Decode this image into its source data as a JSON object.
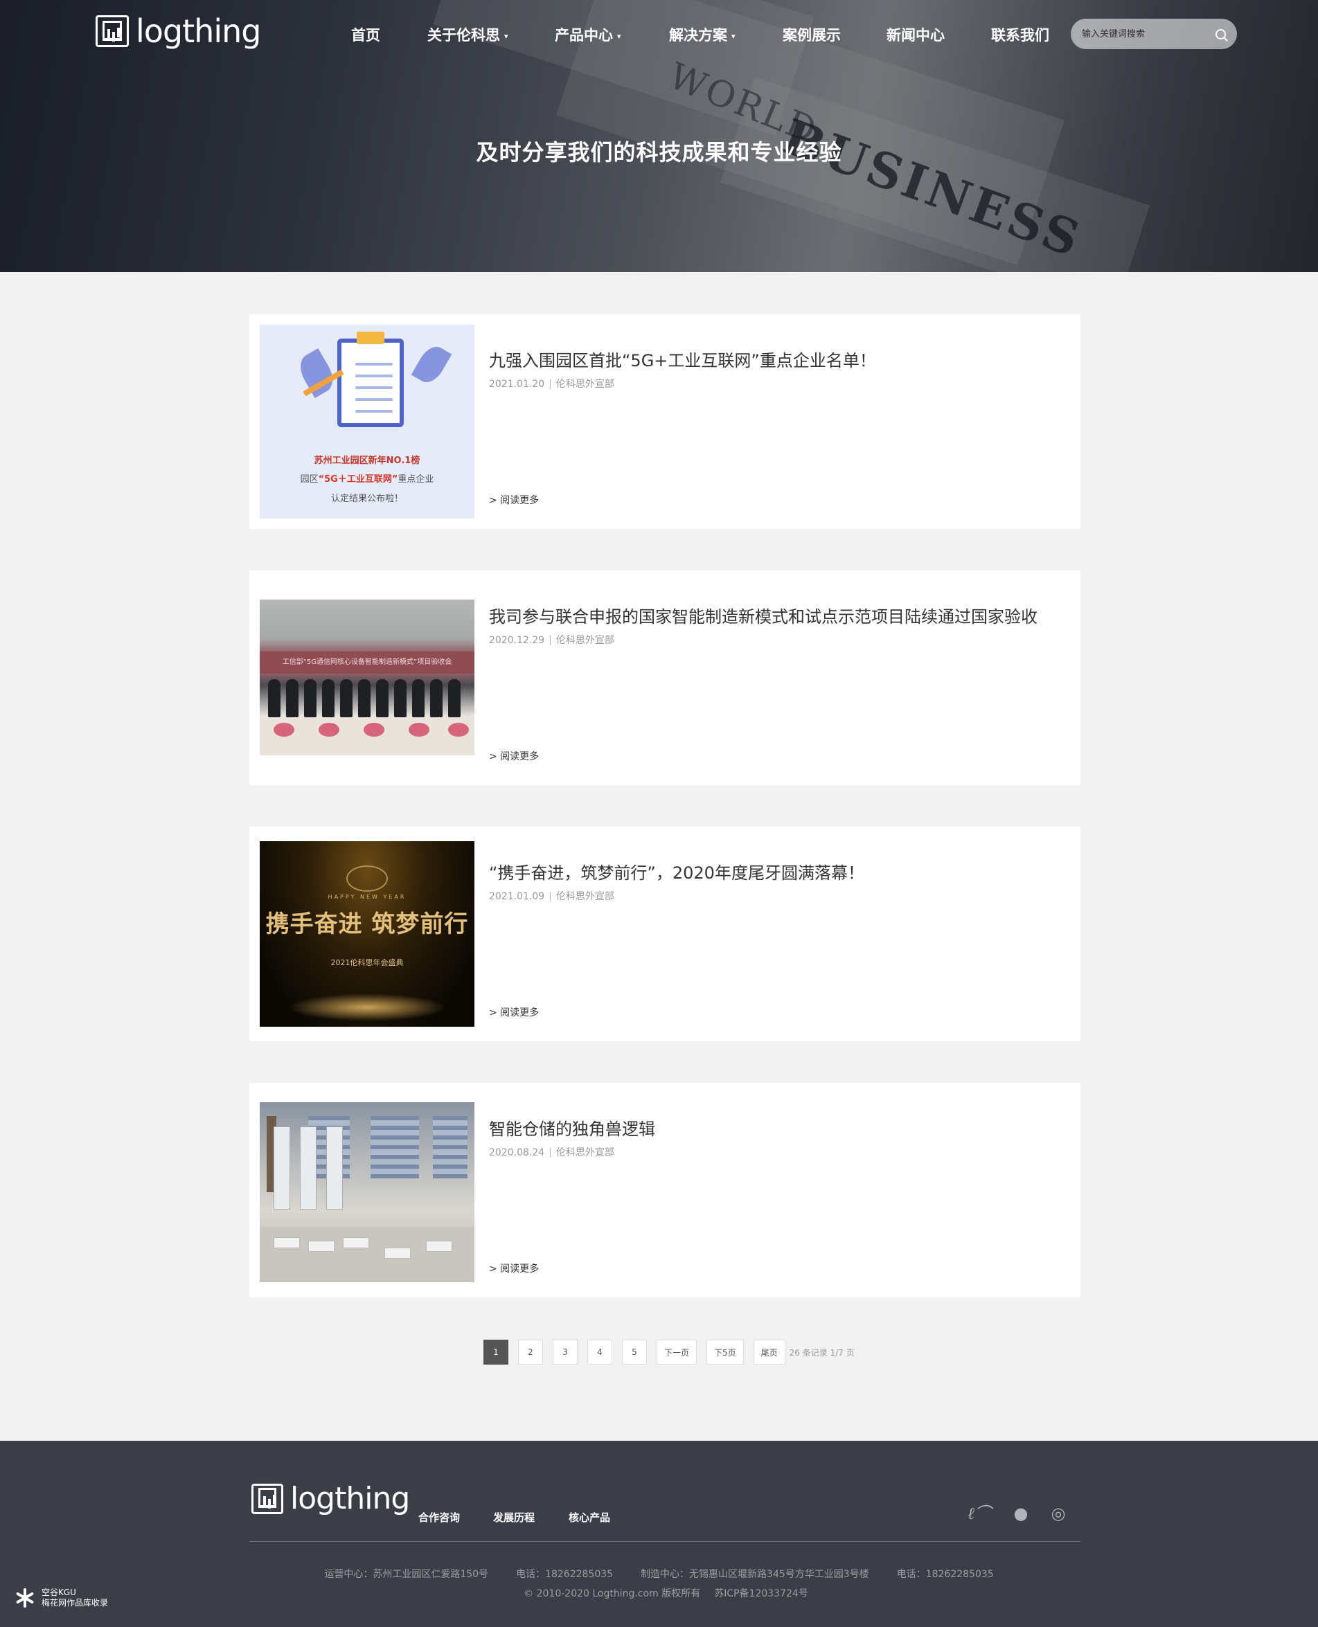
{
  "header": {
    "logo_text": "logthing",
    "nav": [
      {
        "label": "首页",
        "dropdown": false
      },
      {
        "label": "关于伦科思",
        "dropdown": true
      },
      {
        "label": "产品中心",
        "dropdown": true
      },
      {
        "label": "解决方案",
        "dropdown": true
      },
      {
        "label": "案例展示",
        "dropdown": false
      },
      {
        "label": "新闻中心",
        "dropdown": false
      },
      {
        "label": "联系我们",
        "dropdown": false
      }
    ],
    "search_placeholder": "输入关键词搜索"
  },
  "hero": {
    "title": "及时分享我们的科技成果和专业经验",
    "bg_words": [
      "WORLD",
      "BUSINESS"
    ]
  },
  "news": [
    {
      "title": "九强入围园区首批“5G+工业互联网”重点企业名单！",
      "date": "2021.01.20",
      "author": "伦科思外宣部",
      "more": "> 阅读更多",
      "thumb": {
        "cap1": "苏州工业园区新年NO.1榜",
        "cap2_pre": "园区",
        "cap2_em": "“5G＋工业互联网”",
        "cap2_post": "重点企业",
        "cap3": "认定结果公布啦！"
      }
    },
    {
      "title": "我司参与联合申报的国家智能制造新模式和试点示范项目陆续通过国家验收",
      "date": "2020.12.29",
      "author": "伦科思外宣部",
      "more": "> 阅读更多",
      "thumb": {
        "banner": "工信部“5G通信网核心设备智能制造新模式”项目验收会"
      }
    },
    {
      "title": "“携手奋进，筑梦前行”，2020年度尾牙圆满落幕！",
      "date": "2021.01.09",
      "author": "伦科思外宣部",
      "more": "> 阅读更多",
      "thumb": {
        "ny": "HAPPY NEW YEAR",
        "big": "携手奋进 筑梦前行",
        "sub": "2021伦科思年会盛典"
      }
    },
    {
      "title": "智能仓储的独角兽逻辑",
      "date": "2020.08.24",
      "author": "伦科思外宣部",
      "more": "> 阅读更多",
      "thumb": {}
    }
  ],
  "pagination": {
    "pages": [
      "1",
      "2",
      "3",
      "4",
      "5"
    ],
    "current": "1",
    "next": "下一页",
    "next5": "下5页",
    "last": "尾页",
    "info": "26 条记录 1/7 页"
  },
  "footer": {
    "logo_text": "logthing",
    "links": [
      "合作咨询",
      "发展历程",
      "核心产品"
    ],
    "social": [
      "alibaba-icon",
      "wechat-icon",
      "weibo-icon"
    ],
    "ops_center": "运营中心：苏州工业园区仁爱路150号",
    "phone1": "电话：18262285035",
    "mfg_center": "制造中心：无锡惠山区堰新路345号方华工业园3号楼",
    "phone2": "电话：18262285035",
    "copyright": "© 2010-2020 Logthing.com 版权所有",
    "icp": "苏ICP备12033724号"
  },
  "watermark": {
    "line1": "空谷KGU",
    "line2": "梅花网作品库收录"
  }
}
